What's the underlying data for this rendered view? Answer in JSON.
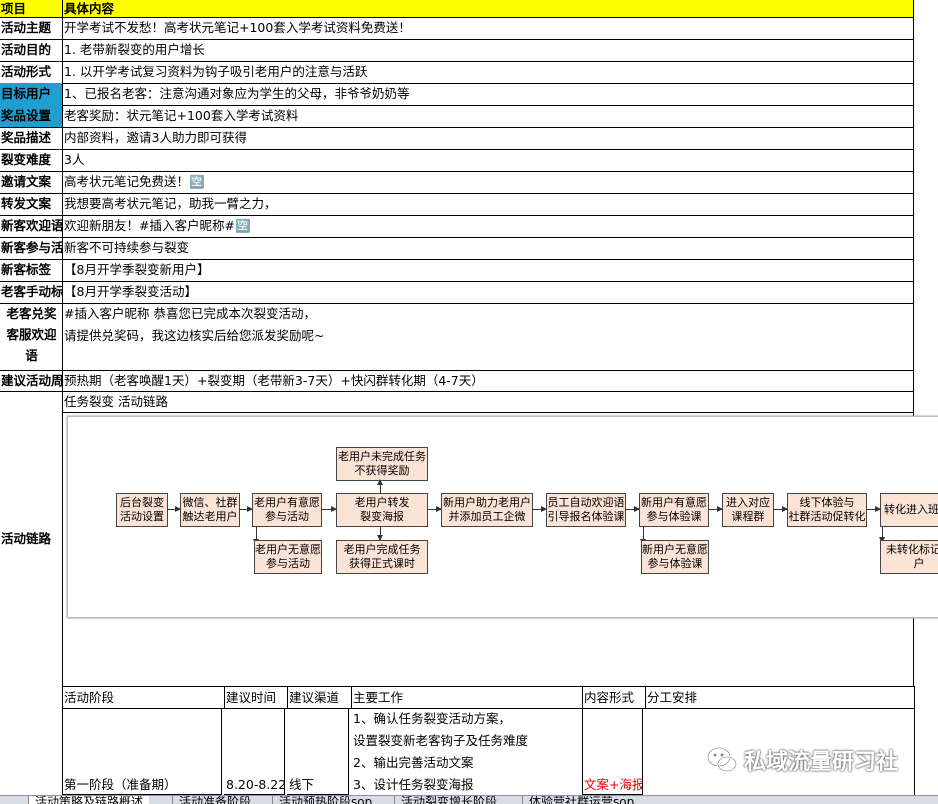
{
  "header": {
    "col1": "项目",
    "col2": "具体内容"
  },
  "rows": [
    {
      "label": "活动主题",
      "value": "开学考试不发愁！高考状元笔记+100套入学考试资料免费送！",
      "blue": false
    },
    {
      "label": "活动目的",
      "value": "1. 老带新裂变的用户增长",
      "blue": false
    },
    {
      "label": "活动形式",
      "value": "1. 以开学考试复习资料为钩子吸引老用户的注意与活跃",
      "blue": false
    },
    {
      "label": "目标用户",
      "value": "1、已报名老客：注意沟通对象应为学生的父母，非爷爷奶奶等",
      "blue": true
    },
    {
      "label": "奖品设置",
      "value": "老客奖励：状元笔记+100套入学考试资料",
      "blue": true
    },
    {
      "label": "奖品描述",
      "value": "内部资料，邀请3人助力即可获得",
      "blue": false
    },
    {
      "label": "裂变难度",
      "value": "3人",
      "blue": false
    },
    {
      "label": "邀请文案",
      "value": "高考状元笔记免费送！🈳",
      "blue": false
    },
    {
      "label": "转发文案",
      "value": "我想要高考状元笔记，助我一臂之力，",
      "blue": false
    },
    {
      "label": "新客欢迎语",
      "value": " 欢迎新朋友！#插入客户昵称#🈳",
      "blue": false
    },
    {
      "label": "新客参与活动",
      "value": "新客不可持续参与裂变",
      "blue": false
    },
    {
      "label": "新客标签",
      "value": "【8月开学季裂变新用户】",
      "blue": false
    },
    {
      "label": "老客手动标签",
      "value": "【8月开学季裂变活动】",
      "blue": false
    }
  ],
  "exchange": {
    "label1": "老客兑奖",
    "label2": "客服欢迎",
    "label3": "语",
    "line1": "#插入客户昵称 恭喜您已完成本次裂变活动，",
    "line2": "请提供兑奖码，我这边核实后给您派发奖励呢~"
  },
  "suggest": {
    "label": "建议活动周期",
    "value": "预热期（老客唤醒1天）+裂变期（老带新3-7天）+快闪群转化期（4-7天）"
  },
  "chain": {
    "label": "活动链路",
    "caption": "任务裂变 活动链路",
    "boxes": {
      "b1": "后台裂变\n活动设置",
      "b2": "微信、社群\n触达老用户",
      "b3": "老用户有意愿\n参与活动",
      "b3b": "老用户无意愿\n参与活动",
      "b4top": "老用户未完成任务\n不获得奖励",
      "b4": "老用户转发\n裂变海报",
      "b4bot": "老用户完成任务\n获得正式课时",
      "b5": "新用户助力老用户\n并添加员工企微",
      "b6": "员工自动欢迎语\n引导报名体验课",
      "b7": "新用户有意愿\n参与体验课",
      "b7b": "新用户无意愿\n参与体验课",
      "b8": "进入对应\n课程群",
      "b9": "线下体验与\n社群活动促转化",
      "b10": "转化进入班级",
      "b10b": "未转化标记用户"
    }
  },
  "plan": {
    "headers": [
      "活动阶段",
      "建议时间",
      "建议渠道",
      "主要工作",
      "内容形式",
      "分工安排"
    ],
    "stage": "第一阶段（准备期）",
    "time": "8.20-8.22",
    "channel": "线下",
    "work": [
      "1、确认任务裂变活动方案，",
      "设置裂变新老客钩子及任务难度",
      "2、输出完善活动文案",
      "3、设计任务裂变海报"
    ],
    "form": "文案+海报"
  },
  "watermark": "私域流量研习社",
  "sheet_tabs": [
    "活动策略及链路概述",
    "活动准备阶段",
    "活动预热阶段sop",
    "活动裂变增长阶段",
    "体验营社群运营sop"
  ],
  "colors": {
    "header": "#ffff00",
    "blue_label": "#1f9ed1",
    "flow_box": "#fbe3d6",
    "red_text": "#e00000"
  }
}
